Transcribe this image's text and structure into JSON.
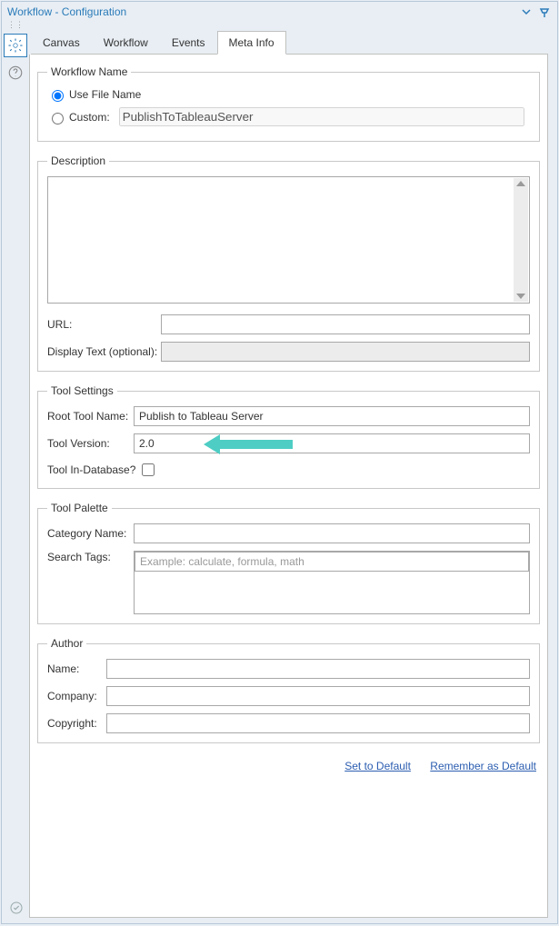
{
  "panel": {
    "title": "Workflow - Configuration"
  },
  "tabs": {
    "canvas": "Canvas",
    "workflow": "Workflow",
    "events": "Events",
    "metainfo": "Meta Info"
  },
  "workflowName": {
    "legend": "Workflow Name",
    "useFileName": "Use File Name",
    "custom": "Custom:",
    "customValue": "PublishToTableauServer"
  },
  "description": {
    "legend": "Description",
    "urlLabel": "URL:",
    "urlValue": "",
    "displayTextLabel": "Display Text (optional):",
    "displayTextValue": ""
  },
  "toolSettings": {
    "legend": "Tool Settings",
    "rootLabel": "Root Tool Name:",
    "rootValue": "Publish to Tableau Server",
    "versionLabel": "Tool Version:",
    "versionValue": "2.0",
    "inDbLabel": "Tool In-Database?"
  },
  "toolPalette": {
    "legend": "Tool Palette",
    "categoryLabel": "Category Name:",
    "categoryValue": "",
    "tagsLabel": "Search Tags:",
    "tagsPlaceholder": "Example: calculate, formula, math"
  },
  "author": {
    "legend": "Author",
    "nameLabel": "Name:",
    "nameValue": "",
    "companyLabel": "Company:",
    "companyValue": "",
    "copyrightLabel": "Copyright:",
    "copyrightValue": ""
  },
  "links": {
    "setDefault": "Set to Default",
    "rememberDefault": "Remember as Default"
  }
}
